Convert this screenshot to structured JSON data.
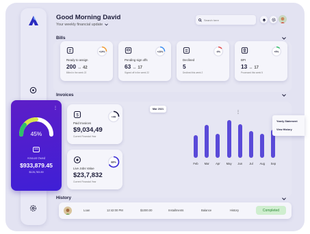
{
  "header": {
    "greeting": "Good Morning David",
    "subtitle": "Your weekly financial update",
    "search_placeholder": "Search here"
  },
  "sections": {
    "bills": "Bills",
    "invoices": "Invoices",
    "history": "History"
  },
  "bills": [
    {
      "label": "Ready to assign",
      "value": "200",
      "sub_value": "42",
      "note": "Billed in the week 22",
      "progress": "+14%",
      "icon": "receipt-icon"
    },
    {
      "label": "Pending sign offs",
      "value": "63",
      "sub_value": "17",
      "note": "Signed off in the week 22",
      "progress": "+23%",
      "icon": "pending-icon"
    },
    {
      "label": "Declined",
      "value": "5",
      "sub_value": "",
      "note": "Declined this week 2",
      "progress": "-9%",
      "icon": "declined-icon"
    },
    {
      "label": "BPI",
      "value": "13",
      "sub_value": "17",
      "note": "Processed this week 5",
      "progress": "+5%",
      "icon": "bpi-icon"
    }
  ],
  "amount_card": {
    "percent": "45%",
    "percent_value": 0.45,
    "label": "Amount Owed",
    "value": "$933,879.45",
    "sub": "$126,783.89"
  },
  "invoice_cards": [
    {
      "label": "Paid Invoices",
      "value": "$9,034,49",
      "sub": "Current Financial Year",
      "badge": "+49",
      "icon": "paid-invoice-icon"
    },
    {
      "label": "Live Jobs Value",
      "value": "$23,7,832",
      "sub": "Current Financial Year",
      "badge": "68%",
      "icon": "live-jobs-icon"
    }
  ],
  "chart_data": {
    "type": "bar",
    "categories": [
      "Feb",
      "Mar",
      "Apr",
      "May",
      "Jun",
      "Jul",
      "Aug",
      "Sep"
    ],
    "values": [
      55,
      80,
      58,
      92,
      82,
      65,
      58,
      68
    ],
    "ylim": [
      0,
      100
    ],
    "highlight_label": "Mar 2021",
    "highlight_index": 1,
    "color": "#5a4ad8"
  },
  "chart_menu": {
    "items": [
      "Yearly Statement",
      "View History"
    ]
  },
  "history_row": {
    "name": "Loan",
    "time": "12:42:00 PM",
    "amount": "$1000.00",
    "type": "Installments",
    "balance": "Balance",
    "col6": "History",
    "status": "Completed"
  },
  "colors": {
    "accent": "#3a2bd6",
    "success": "#2d8a35"
  }
}
